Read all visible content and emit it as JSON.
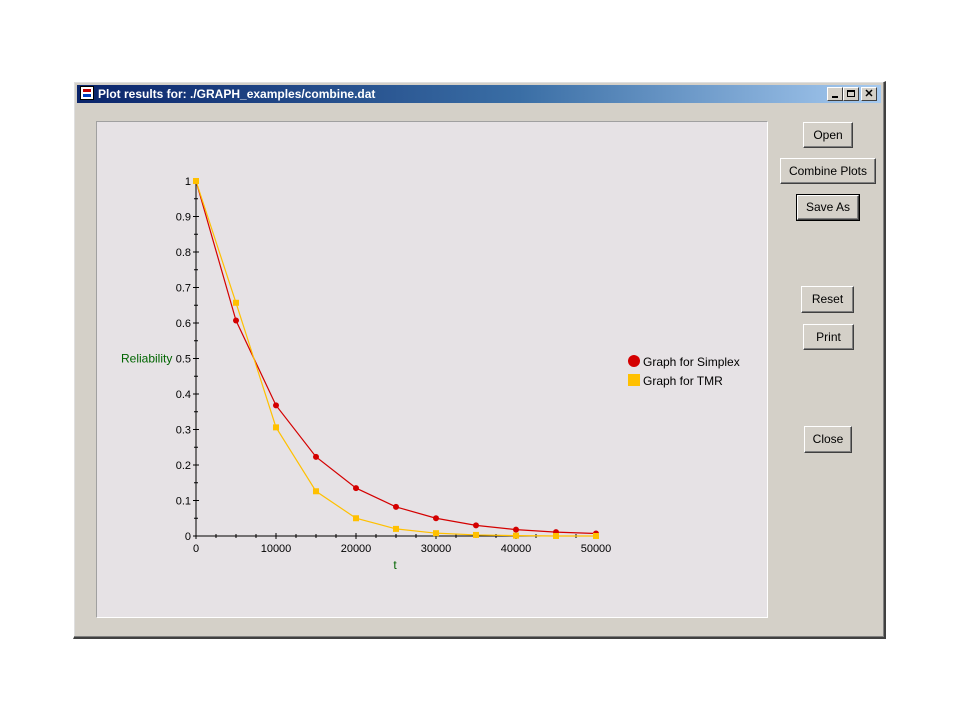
{
  "window": {
    "title": "Plot results for: ./GRAPH_examples/combine.dat",
    "controls": {
      "minimize_icon": "minimize-icon",
      "maximize_icon": "maximize-icon",
      "close_icon": "close-icon",
      "close_glyph": "✕"
    }
  },
  "buttons": {
    "open": "Open",
    "combine": "Combine Plots",
    "save_as": "Save As",
    "reset": "Reset",
    "print": "Print",
    "close": "Close"
  },
  "chart_data": {
    "type": "line",
    "xlabel": "t",
    "ylabel": "Reliability",
    "xlim": [
      0,
      50000
    ],
    "ylim": [
      0,
      1
    ],
    "xticks": [
      0,
      10000,
      20000,
      30000,
      40000,
      50000
    ],
    "xtick_labels": [
      "0",
      "10000",
      "20000",
      "30000",
      "40000",
      "50000"
    ],
    "yticks": [
      0,
      0.1,
      0.2,
      0.3,
      0.4,
      0.5,
      0.6,
      0.7,
      0.8,
      0.9,
      1
    ],
    "ytick_labels": [
      "0",
      "0.1",
      "0.2",
      "0.3",
      "0.4",
      "0.5",
      "0.6",
      "0.7",
      "0.8",
      "0.9",
      "1"
    ],
    "x": [
      0,
      5000,
      10000,
      15000,
      20000,
      25000,
      30000,
      35000,
      40000,
      45000,
      50000
    ],
    "series": [
      {
        "name": "Graph for Simplex",
        "color": "#d40000",
        "marker": "circle",
        "values": [
          1.0,
          0.607,
          0.368,
          0.223,
          0.135,
          0.082,
          0.05,
          0.03,
          0.018,
          0.011,
          0.007
        ]
      },
      {
        "name": "Graph for TMR",
        "color": "#ffc000",
        "marker": "square",
        "values": [
          1.0,
          0.657,
          0.306,
          0.126,
          0.05,
          0.02,
          0.008,
          0.003,
          0.001,
          0.0,
          0.0
        ]
      }
    ],
    "grid": false,
    "legend_position": "right",
    "axis_label_color": "#006400"
  }
}
